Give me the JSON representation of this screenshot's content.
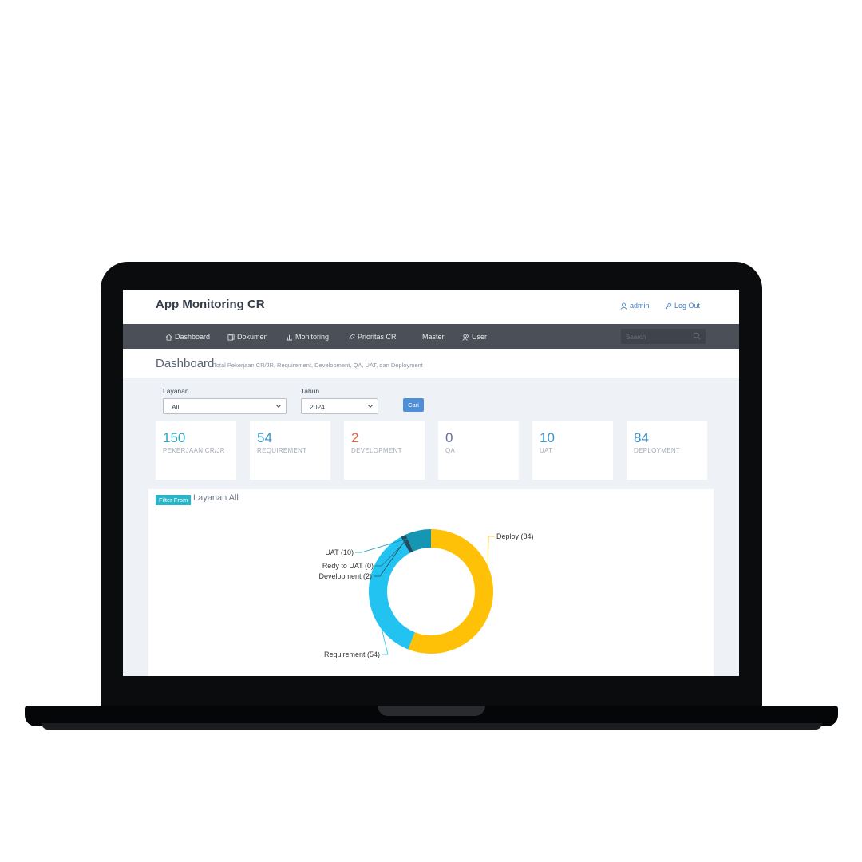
{
  "header": {
    "app_title": "App Monitoring CR",
    "user_label": "admin",
    "logout_label": "Log Out"
  },
  "nav": {
    "items": [
      {
        "label": "Dashboard",
        "icon": "home-icon"
      },
      {
        "label": "Dokumen",
        "icon": "document-icon"
      },
      {
        "label": "Monitoring",
        "icon": "bar-chart-icon"
      },
      {
        "label": "Prioritas CR",
        "icon": "rocket-icon"
      },
      {
        "label": "Master",
        "icon": ""
      },
      {
        "label": "User",
        "icon": "users-icon"
      }
    ],
    "search_placeholder": "Search"
  },
  "page": {
    "title": "Dashboard",
    "subtitle": "Total Pekerjaan CR/JR, Requirement, Development, QA, UAT, dan Deployment"
  },
  "filters": {
    "layanan_label": "Layanan",
    "layanan_value": "All",
    "tahun_label": "Tahun",
    "tahun_value": "2024",
    "search_button": "Cari"
  },
  "cards": [
    {
      "value": "150",
      "label": "PEKERJAAN CR/JR",
      "color": "#2aa8c4"
    },
    {
      "value": "54",
      "label": "REQUIREMENT",
      "color": "#3a95c9"
    },
    {
      "value": "2",
      "label": "DEVELOPMENT",
      "color": "#e0663f"
    },
    {
      "value": "0",
      "label": "QA",
      "color": "#6a6f9e"
    },
    {
      "value": "10",
      "label": "UAT",
      "color": "#3a95c9"
    },
    {
      "value": "84",
      "label": "DEPLOYMENT",
      "color": "#3a8cc2"
    }
  ],
  "panel": {
    "badge": "Filter From",
    "text": "Layanan All"
  },
  "chart_data": {
    "type": "pie",
    "donut": true,
    "labels": [
      "Deploy (84)",
      "Requirement (54)",
      "Development (2)",
      "Redy to UAT (0)",
      "UAT (10)"
    ],
    "values": [
      84,
      54,
      2,
      0,
      10
    ],
    "colors": [
      "#ffc107",
      "#22c3f0",
      "#1f4e64",
      "#2a6f86",
      "#1596b2"
    ]
  }
}
